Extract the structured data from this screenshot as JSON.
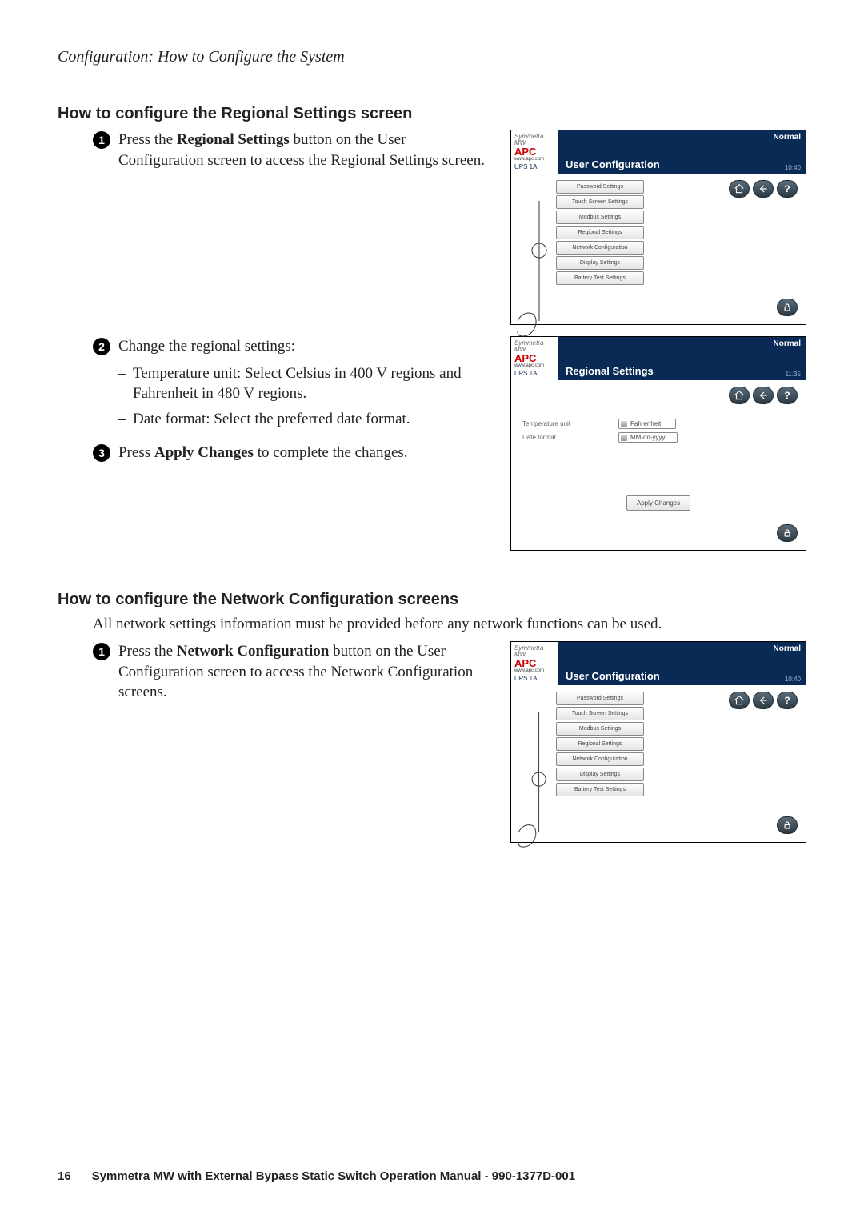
{
  "page": {
    "running_head": "Configuration: How to Configure the System",
    "number": "16",
    "footer_title": "Symmetra MW with External Bypass Static Switch Operation Manual - 990-1377D-001"
  },
  "section_regional": {
    "heading": "How to configure the Regional Settings screen",
    "steps": [
      {
        "n": "1",
        "pre": "Press the ",
        "bold": "Regional Settings",
        "post": " button on the User Configuration screen to access the Regional Settings screen."
      },
      {
        "n": "2",
        "pre": "Change the regional settings:",
        "bold": "",
        "post": "",
        "bullets": [
          "Temperature unit: Select Celsius in 400 V regions and Fahrenheit in 480 V regions.",
          "Date format: Select the preferred date format."
        ]
      },
      {
        "n": "3",
        "pre": "Press ",
        "bold": "Apply Changes",
        "post": " to complete the changes."
      }
    ]
  },
  "section_network": {
    "heading": "How to configure the Network Configuration screens",
    "intro": "All network settings information must be provided before any network functions can be used.",
    "steps": [
      {
        "n": "1",
        "pre": "Press the ",
        "bold": "Network Configuration",
        "post": " button on the User Configuration screen to access the Network Configuration screens."
      }
    ]
  },
  "screenshot_common": {
    "prodline": "Symmetra MW",
    "brand": "APC",
    "url": "www.apc.com",
    "ups": "UPS 1A",
    "status": "Normal",
    "menu_items": [
      "Password Settings",
      "Touch Screen Settings",
      "Modbus Settings",
      "Regional Settings",
      "Network Configuration",
      "Display Settings",
      "Battery Test Settings"
    ]
  },
  "shot_user_cfg": {
    "title": "User Configuration",
    "time": "10:40"
  },
  "shot_regional": {
    "title": "Regional Settings",
    "time": "11:35",
    "rows": [
      {
        "label": "Temperature unit",
        "value": "Fahrenheit"
      },
      {
        "label": "Date format",
        "value": "MM-dd-yyyy"
      }
    ],
    "apply": "Apply Changes"
  },
  "shot_user_cfg2_time": "10:40"
}
